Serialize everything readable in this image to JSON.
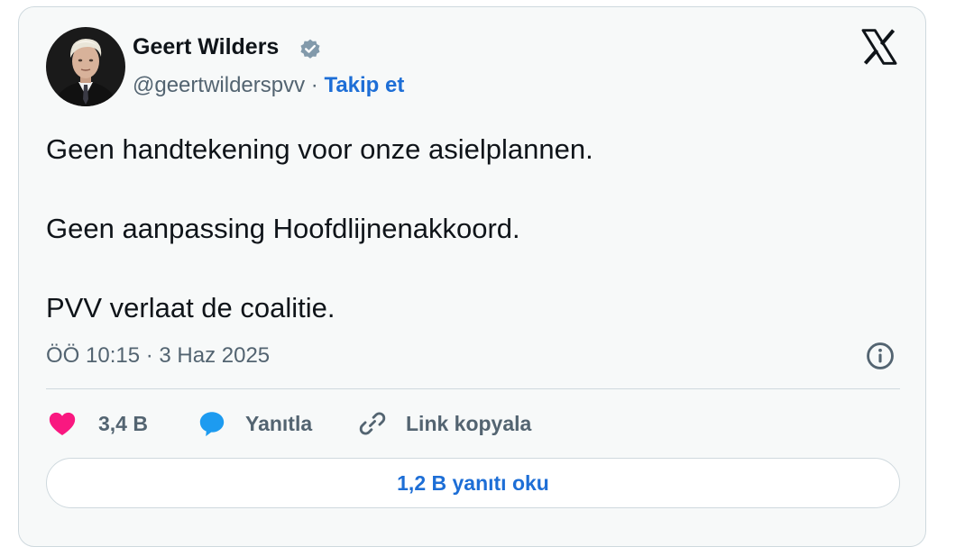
{
  "author": {
    "name": "Geert Wilders",
    "handle": "@geertwilderspvv",
    "separator": " · ",
    "follow_label": "Takip et"
  },
  "tweet": {
    "lines": [
      "Geen handtekening voor onze asielplannen.",
      "Geen aanpassing Hoofdlijnenakkoord.",
      "PVV verlaat de coalitie."
    ],
    "timestamp": "ÖÖ 10:15 · 3 Haz 2025"
  },
  "actions": {
    "like_count": "3,4 B",
    "reply_label": "Yanıtla",
    "copy_link_label": "Link kopyala"
  },
  "read_replies_label": "1,2 B yanıtı oku",
  "icons": {
    "avatar": "profile-photo",
    "verified": "verified-badge-icon",
    "platform": "x-logo-icon",
    "info": "info-icon",
    "like": "heart-icon",
    "reply": "speech-bubble-icon",
    "link": "link-chain-icon"
  },
  "colors": {
    "card_background": "#f7f9f9",
    "border": "#cfd9de",
    "text_primary": "#0f1419",
    "text_secondary": "#536471",
    "link_blue": "#1d6ed6",
    "heart_pink": "#f91880",
    "reply_blue": "#1d9bf0",
    "verified_gray": "#829aab"
  }
}
